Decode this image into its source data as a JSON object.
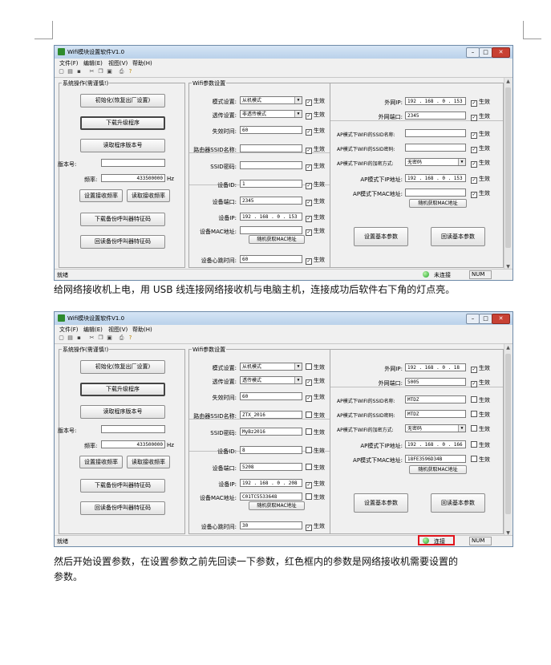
{
  "window": {
    "title": "Wifi模块设置软件V1.0",
    "menu": [
      "文件(F)",
      "编辑(E)",
      "视图(V)",
      "帮助(H)"
    ],
    "status_ready": "就绪",
    "status_num": "NUM"
  },
  "left_panel": {
    "group_title": "系统操作(需谨慎!)",
    "init_button": "初始化(恢复出厂设置)",
    "download_button": "下载升级程序",
    "read_version_button": "读取程序版本号",
    "version_label": "版本号:",
    "freq_label": "频率:",
    "freq_value": "433500000",
    "freq_unit": "Hz",
    "set_freq_button": "设置接收频率",
    "read_freq_button": "读取接收频率",
    "download_code_button": "下载备份呼叫器特征码",
    "read_code_button": "回读备份呼叫器特征码"
  },
  "wifi_panel": {
    "group_title": "Wifi参数设置",
    "mode_label": "模式设置:",
    "transfer_label": "透传设置:",
    "timeout_label": "失效时间:",
    "router_ssid_label": "路由器SSID名称:",
    "ssid_pwd_label": "SSID密码:",
    "device_id_label": "设备ID:",
    "device_port_label": "设备端口:",
    "device_ip_label": "设备IP:",
    "device_mac_label": "设备MAC地址:",
    "random_mac_button": "随机获取MAC地址",
    "heartbeat_label": "设备心跳时间:",
    "ext_ip_label": "外网IP:",
    "ext_port_label": "外网端口:",
    "ap_ssid_label": "AP模式下WIFI的SSID名称:",
    "ap_pwd_label": "AP模式下WIFI的SSID密码:",
    "ap_enc_label": "AP模式下WIFI的加密方式:",
    "ap_ip_label": "AP模式下IP地址:",
    "ap_mac_label": "AP模式下MAC地址:",
    "set_params_button": "设置基本参数",
    "read_params_button": "回读基本参数",
    "enable_label": "生效"
  },
  "screen1": {
    "mode_value": "从机模式",
    "transfer_value": "非透传模式",
    "timeout_value": "60",
    "router_ssid_value": "",
    "ssid_pwd_value": "",
    "device_id_value": "1",
    "device_port_value": "2345",
    "device_ip_value": "192 . 168 . 0 . 153",
    "device_mac_value": "",
    "heartbeat_value": "60",
    "ext_ip_value": "192 . 168 . 0 . 153",
    "ext_port_value": "2345",
    "ap_ssid_value": "",
    "ap_pwd_value": "",
    "ap_enc_value": "无密码",
    "ap_ip_value": "192 . 168 . 0 . 153",
    "ap_mac_value": "",
    "status_conn": "未连接",
    "checks": {
      "mode": true,
      "transfer": true,
      "timeout": true,
      "router_ssid": true,
      "ssid_pwd": true,
      "device_id": true,
      "device_port": true,
      "device_ip": true,
      "device_mac": true,
      "heartbeat": true,
      "ext_ip": true,
      "ext_port": true,
      "ap_ssid": true,
      "ap_pwd": true,
      "ap_enc": true,
      "ap_ip": true,
      "ap_mac": true
    }
  },
  "screen2": {
    "mode_value": "从机模式",
    "transfer_value": "透传模式",
    "timeout_value": "60",
    "router_ssid_value": "ZTX_2016",
    "ssid_pwd_value": "MyBz2016",
    "device_id_value": "8",
    "device_port_value": "5208",
    "device_ip_value": "192 . 168 . 0 . 208",
    "device_mac_value": "C01TC5533648",
    "heartbeat_value": "30",
    "ext_ip_value": "192 . 168 . 0 . 18",
    "ext_port_value": "5005",
    "ap_ssid_value": "MTDZ",
    "ap_pwd_value": "MTDZ",
    "ap_enc_value": "无密码",
    "ap_ip_value": "192 . 168 . 0 . 166",
    "ap_mac_value": "18FE3596D34B",
    "status_conn": "连接",
    "checks": {
      "mode": false,
      "transfer": true,
      "timeout": true,
      "router_ssid": false,
      "ssid_pwd": false,
      "device_id": false,
      "device_port": false,
      "device_ip": true,
      "device_mac": false,
      "heartbeat": true,
      "ext_ip": true,
      "ext_port": true,
      "ap_ssid": false,
      "ap_pwd": false,
      "ap_enc": false,
      "ap_ip": false,
      "ap_mac": false
    }
  },
  "paragraphs": {
    "p1": "给网络接收机上电，用 USB 线连接网络接收机与电脑主机，连接成功后软件右下角的灯点亮。",
    "p2_line1": "然后开始设置参数，在设置参数之前先回读一下参数，红色框内的参数是网络接收机需要设置的",
    "p2_line2": "参数。"
  }
}
